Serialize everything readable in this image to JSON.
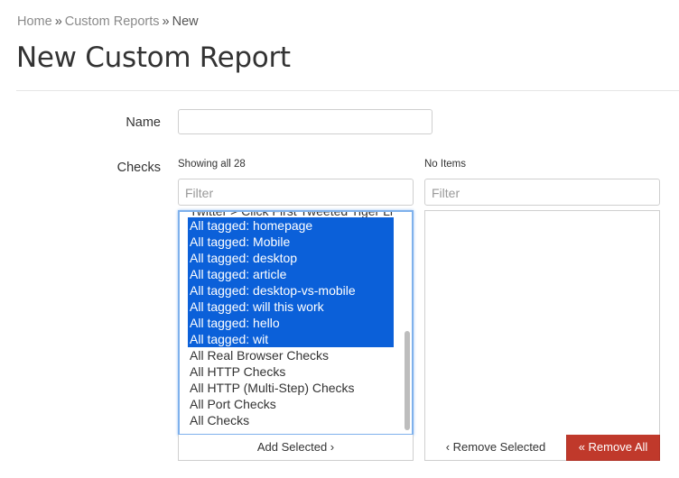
{
  "breadcrumb": {
    "home": "Home",
    "separator": "»",
    "custom_reports": "Custom Reports",
    "current": "New"
  },
  "page_title": "New Custom Report",
  "form": {
    "name_label": "Name",
    "name_value": "",
    "checks_label": "Checks"
  },
  "available": {
    "count_text": "Showing all 28",
    "filter_placeholder": "Filter",
    "partial_item": "Twitter > Click First Tweeted Tiger Li",
    "items": [
      {
        "label": "All tagged: homepage",
        "selected": true
      },
      {
        "label": "All tagged: Mobile",
        "selected": true
      },
      {
        "label": "All tagged: desktop",
        "selected": true
      },
      {
        "label": "All tagged: article",
        "selected": true
      },
      {
        "label": "All tagged: desktop-vs-mobile",
        "selected": true
      },
      {
        "label": "All tagged: will this work",
        "selected": true
      },
      {
        "label": "All tagged: hello",
        "selected": true
      },
      {
        "label": "All tagged: wit",
        "selected": true
      },
      {
        "label": "All Real Browser Checks",
        "selected": false
      },
      {
        "label": "All HTTP Checks",
        "selected": false
      },
      {
        "label": "All HTTP (Multi-Step) Checks",
        "selected": false
      },
      {
        "label": "All Port Checks",
        "selected": false
      },
      {
        "label": "All Checks",
        "selected": false
      }
    ],
    "add_button": "Add Selected ›"
  },
  "selected_list": {
    "count_text": "No Items",
    "filter_placeholder": "Filter",
    "items": [],
    "remove_selected_button": "‹ Remove Selected",
    "remove_all_button": "« Remove All"
  },
  "colors": {
    "selection": "#0b60d9",
    "danger": "#c0392b",
    "focus_border": "#7fb1ec"
  }
}
